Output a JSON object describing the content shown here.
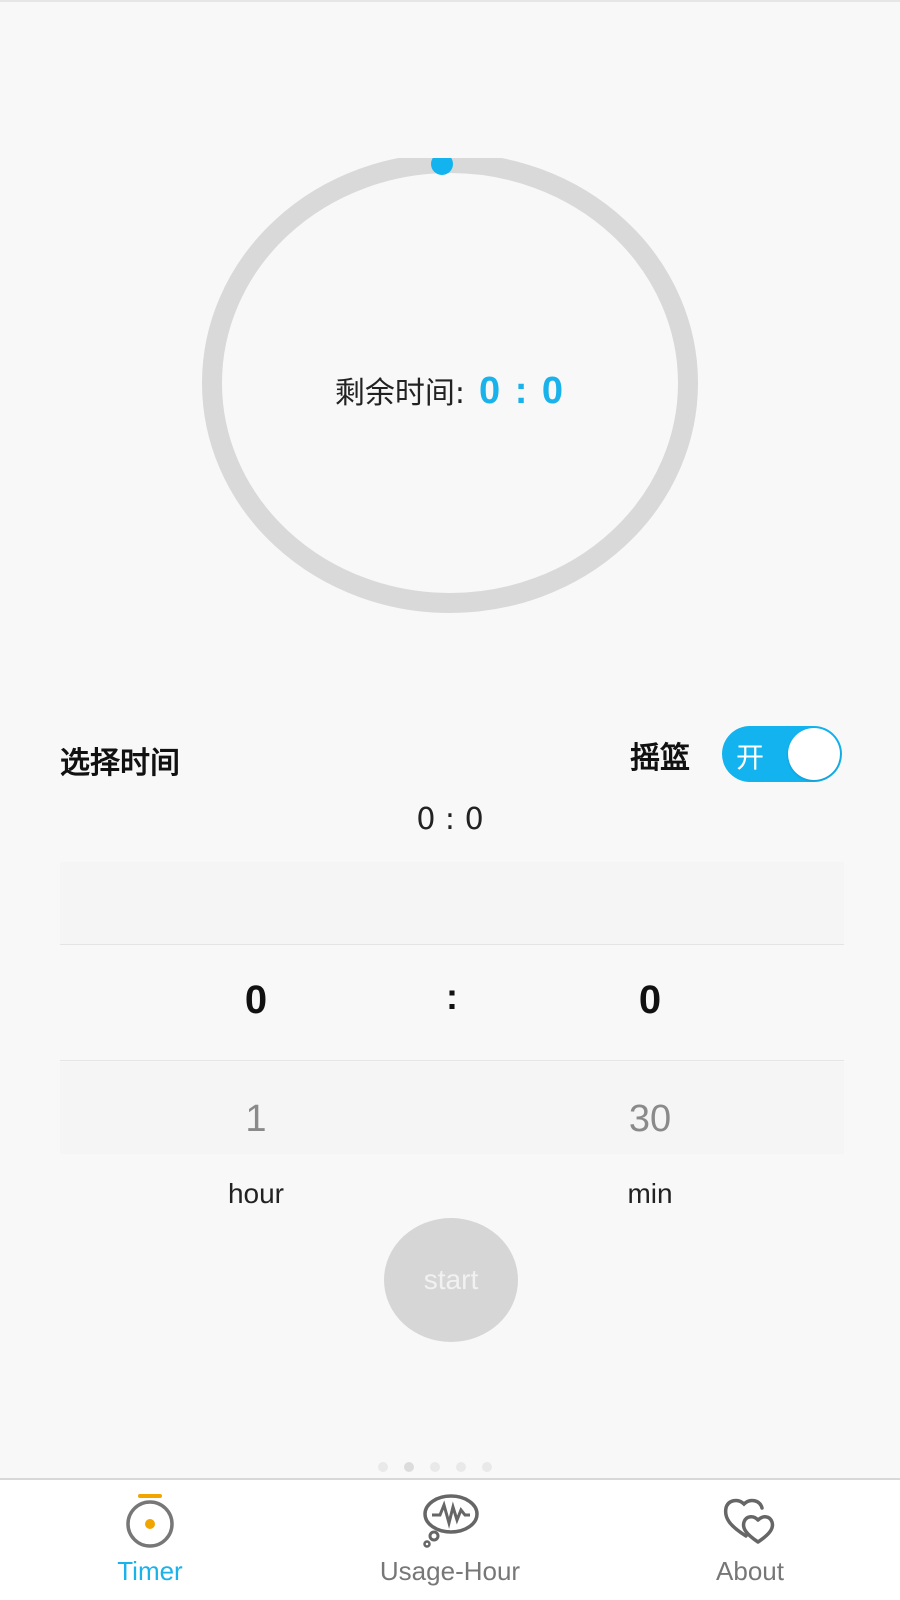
{
  "timer": {
    "remaining_label": "剩余时间:",
    "remaining_value": "0 : 0",
    "progress": 0
  },
  "settings": {
    "select_time_title": "选择时间",
    "cradle_label": "摇篮",
    "cradle_toggle_text": "开",
    "cradle_on": true,
    "selected_display": "0 : 0"
  },
  "picker": {
    "hour_selected": "0",
    "minute_selected": "0",
    "separator": ":",
    "hour_next": "1",
    "minute_next": "30",
    "hour_unit": "hour",
    "minute_unit": "min"
  },
  "actions": {
    "start_label": "start"
  },
  "tabs": [
    {
      "label": "Timer",
      "icon": "timer-icon",
      "active": true
    },
    {
      "label": "Usage-Hour",
      "icon": "usage-chat-icon",
      "active": false
    },
    {
      "label": "About",
      "icon": "hearts-icon",
      "active": false
    }
  ],
  "colors": {
    "accent": "#1ab2ea",
    "toggle_on": "#12b3ef",
    "ring": "#d9d9d9",
    "timer_icon_accent": "#f0a500",
    "button_disabled": "#d6d6d6"
  }
}
